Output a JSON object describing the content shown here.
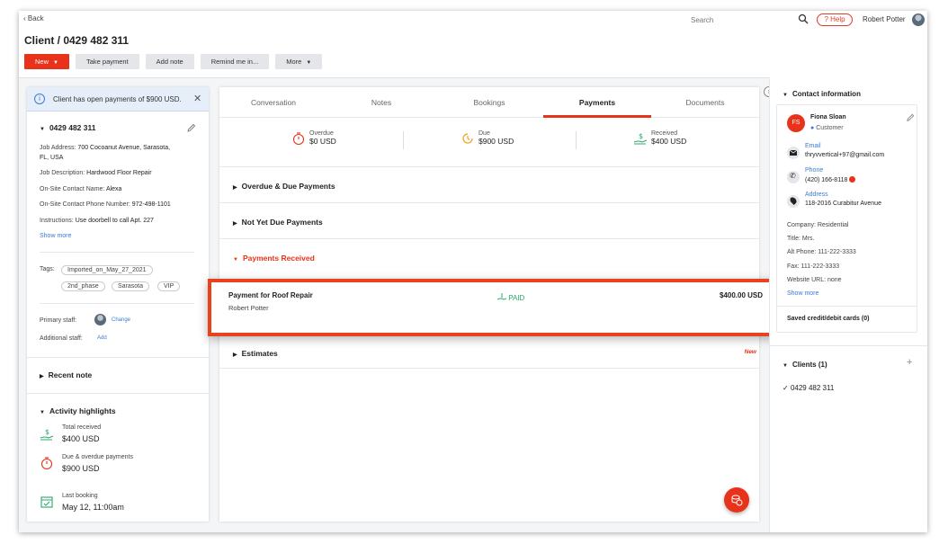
{
  "topbar": {
    "back_label": "Back",
    "search_placeholder": "Search",
    "help_label": "Help",
    "user_name": "Robert Potter"
  },
  "page": {
    "title": "Client / 0429 482 311"
  },
  "actions": {
    "new_label": "New",
    "take_payment_label": "Take payment",
    "add_note_label": "Add note",
    "remind_label": "Remind me in...",
    "more_label": "More"
  },
  "left": {
    "banner": "Client has open payments of $900 USD.",
    "client_number": "0429 482 311",
    "details": [
      {
        "label": "Job Address:",
        "value": "700 Cocoanut Avenue, Sarasota,"
      },
      {
        "label": "",
        "value": "FL, USA"
      },
      {
        "label": "Job Description:",
        "value": "Hardwood Floor Repair"
      },
      {
        "label": "On-Site Contact Name:",
        "value": "Alexa"
      },
      {
        "label": "On-Site Contact Phone Number:",
        "value": "972-498-1101"
      },
      {
        "label": "Instructions:",
        "value": "Use doorbell to call Apt. 227"
      }
    ],
    "show_more": "Show more",
    "tags_label": "Tags:",
    "tags": [
      "Imported_on_May_27_2021",
      "2nd_phase",
      "Sarasota",
      "VIP"
    ],
    "primary_staff_label": "Primary staff:",
    "change_label": "Change",
    "additional_staff_label": "Additional staff:",
    "add_label": "Add",
    "recent_note": "Recent note",
    "activity_title": "Activity highlights",
    "highlights": [
      {
        "label": "Total received",
        "value": "$400 USD"
      },
      {
        "label": "Due & overdue payments",
        "value": "$900 USD"
      },
      {
        "label": "Last booking",
        "value": "May 12, 11:00am"
      }
    ]
  },
  "center": {
    "tabs": [
      "Conversation",
      "Notes",
      "Bookings",
      "Payments",
      "Documents"
    ],
    "summary": [
      {
        "label": "Overdue",
        "value": "$0 USD"
      },
      {
        "label": "Due",
        "value": "$900 USD"
      },
      {
        "label": "Received",
        "value": "$400 USD"
      }
    ],
    "sections": {
      "overdue": "Overdue & Due Payments",
      "not_yet": "Not Yet Due Payments",
      "received": "Payments Received",
      "estimates": "Estimates",
      "new_tag": "New"
    },
    "payment": {
      "title": "Payment for Roof Repair",
      "name": "Robert Potter",
      "status": "PAID",
      "amount": "$400.00 USD"
    }
  },
  "right": {
    "contact_title": "Contact information",
    "initials": "FS",
    "name": "Fiona Sloan",
    "role": "Customer",
    "email_label": "Email",
    "email": "thryvvertical+97@gmail.com",
    "phone_label": "Phone",
    "phone": "(420) 166-8118",
    "address_label": "Address",
    "address": "118-2016 Curabitur Avenue",
    "fields": [
      "Company: Residential",
      "Title: Mrs.",
      "Alt Phone: 111-222-3333",
      "Fax: 111-222-3333",
      "Website URL: none"
    ],
    "show_more": "Show more",
    "saved_cards": "Saved credit/debit cards (0)",
    "clients_title": "Clients (1)",
    "client_item": "0429 482 311"
  },
  "colors": {
    "accent": "#e8321a",
    "paid": "#2ba86a",
    "link": "#3a7bd5"
  }
}
